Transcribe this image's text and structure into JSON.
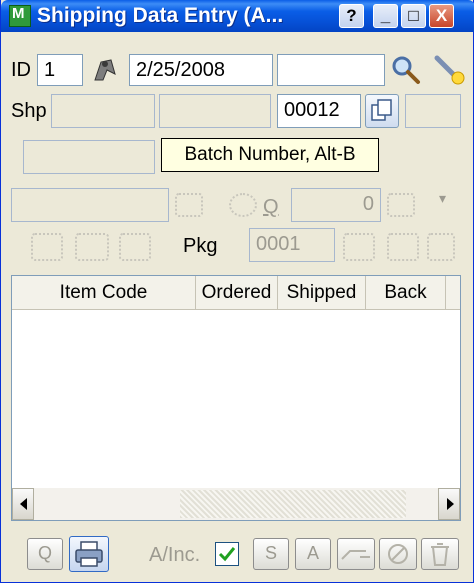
{
  "window": {
    "title": "Shipping Data Entry (A...",
    "help_label": "?",
    "minimize_label": "_",
    "maximize_label": "□",
    "close_label": "X"
  },
  "row1": {
    "id_label": "ID",
    "id_value": "1",
    "date_value": "2/25/2008"
  },
  "row2": {
    "shp_label": "Shp",
    "batch_value": "00012"
  },
  "tooltip": {
    "text": "Batch Number, Alt-B"
  },
  "row4": {
    "q_label": "Q",
    "qty_value": "0"
  },
  "row5": {
    "pkg_label": "Pkg",
    "pkg_value": "0001"
  },
  "grid": {
    "columns": [
      "Item Code",
      "Ordered",
      "Shipped",
      "Back"
    ]
  },
  "bottom": {
    "q_button": "Q",
    "ainc_label": "A/Inc.",
    "s_button": "S",
    "a_button": "A"
  }
}
